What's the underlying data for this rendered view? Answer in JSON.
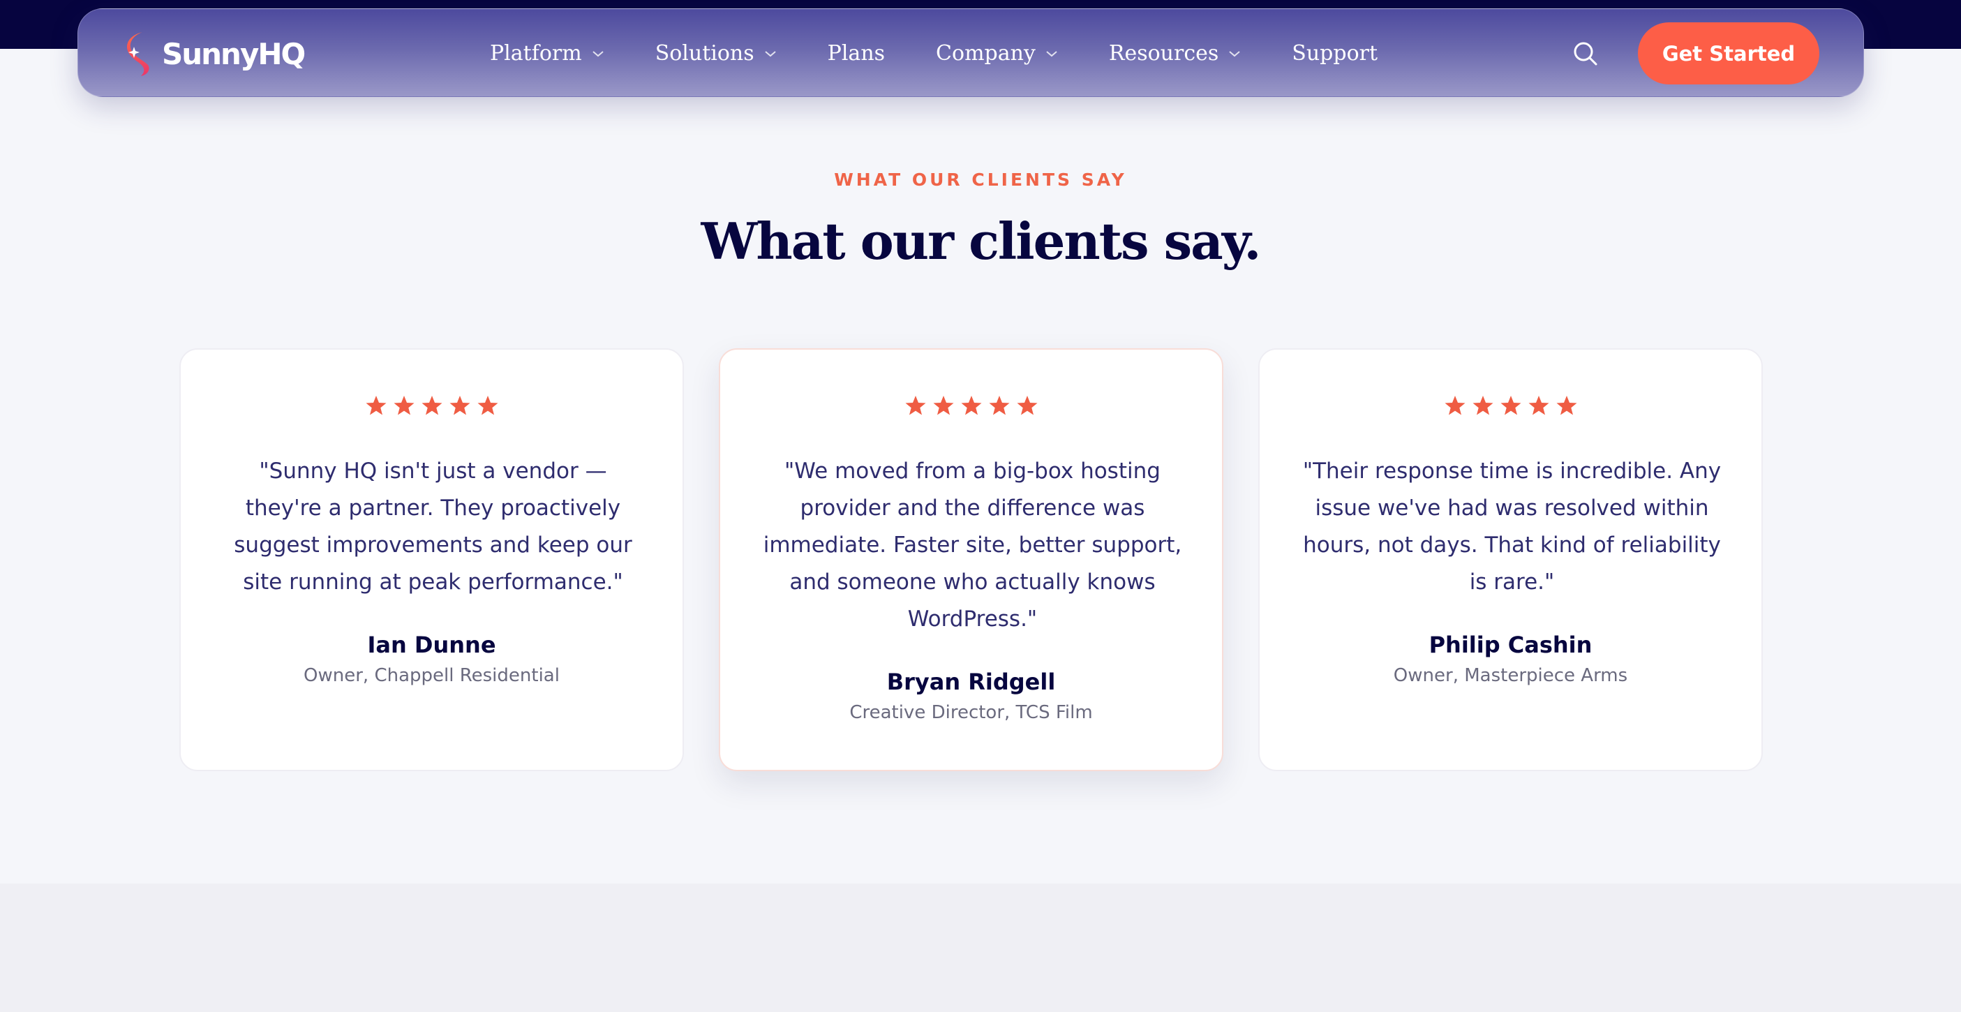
{
  "brand": {
    "name": "SunnyHQ",
    "primary_color": "#06043f",
    "accent_color": "#fd5e47",
    "logo_icon": "sunny-logo-icon"
  },
  "nav": {
    "items": [
      {
        "label": "Platform",
        "has_dropdown": true
      },
      {
        "label": "Solutions",
        "has_dropdown": true
      },
      {
        "label": "Plans",
        "has_dropdown": false
      },
      {
        "label": "Company",
        "has_dropdown": true
      },
      {
        "label": "Resources",
        "has_dropdown": true
      },
      {
        "label": "Support",
        "has_dropdown": false
      }
    ],
    "search_icon": "search-icon",
    "cta_label": "Get Started"
  },
  "testimonials_section": {
    "eyebrow": "WHAT OUR CLIENTS SAY",
    "title": "What our clients say.",
    "star_color": "#ef5c43",
    "cards": [
      {
        "rating": 5,
        "quote": "\"Sunny HQ isn't just a vendor — they're a partner. They proactively suggest improvements and keep our site running at peak performance.\"",
        "author": "Ian Dunne",
        "role": "Owner, Chappell Residential",
        "featured": false
      },
      {
        "rating": 5,
        "quote": "\"We moved from a big-box hosting provider and the difference was immediate. Faster site, better support, and someone who actually knows WordPress.\"",
        "author": "Bryan Ridgell",
        "role": "Creative Director, TCS Film",
        "featured": true
      },
      {
        "rating": 5,
        "quote": "\"Their response time is incredible. Any issue we've had was resolved within hours, not days. That kind of reliability is rare.\"",
        "author": "Philip Cashin",
        "role": "Owner, Masterpiece Arms",
        "featured": false
      }
    ]
  }
}
